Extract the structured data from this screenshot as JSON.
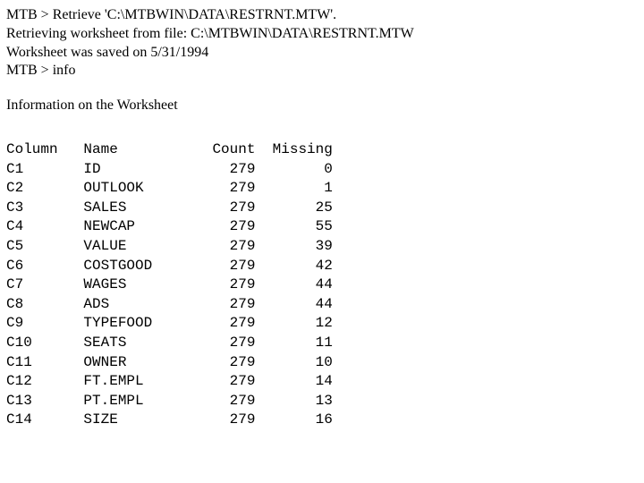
{
  "header": {
    "line1": "MTB > Retrieve  'C:\\MTBWIN\\DATA\\RESTRNT.MTW'.",
    "line2": "Retrieving worksheet from file: C:\\MTBWIN\\DATA\\RESTRNT.MTW",
    "line3": "Worksheet was saved on  5/31/1994",
    "line4": "MTB > info"
  },
  "info_title": "Information on the Worksheet",
  "table": {
    "headers": {
      "column": "Column",
      "name": "Name",
      "count": "Count",
      "missing": "Missing"
    },
    "rows": [
      {
        "column": "C1",
        "name": "ID",
        "count": "279",
        "missing": "0"
      },
      {
        "column": "C2",
        "name": "OUTLOOK",
        "count": "279",
        "missing": "1"
      },
      {
        "column": "C3",
        "name": "SALES",
        "count": "279",
        "missing": "25"
      },
      {
        "column": "C4",
        "name": "NEWCAP",
        "count": "279",
        "missing": "55"
      },
      {
        "column": "C5",
        "name": "VALUE",
        "count": "279",
        "missing": "39"
      },
      {
        "column": "C6",
        "name": "COSTGOOD",
        "count": "279",
        "missing": "42"
      },
      {
        "column": "C7",
        "name": "WAGES",
        "count": "279",
        "missing": "44"
      },
      {
        "column": "C8",
        "name": "ADS",
        "count": "279",
        "missing": "44"
      },
      {
        "column": "C9",
        "name": "TYPEFOOD",
        "count": "279",
        "missing": "12"
      },
      {
        "column": "C10",
        "name": "SEATS",
        "count": "279",
        "missing": "11"
      },
      {
        "column": "C11",
        "name": "OWNER",
        "count": "279",
        "missing": "10"
      },
      {
        "column": "C12",
        "name": "FT.EMPL",
        "count": "279",
        "missing": "14"
      },
      {
        "column": "C13",
        "name": "PT.EMPL",
        "count": "279",
        "missing": "13"
      },
      {
        "column": "C14",
        "name": "SIZE",
        "count": "279",
        "missing": "16"
      }
    ]
  }
}
